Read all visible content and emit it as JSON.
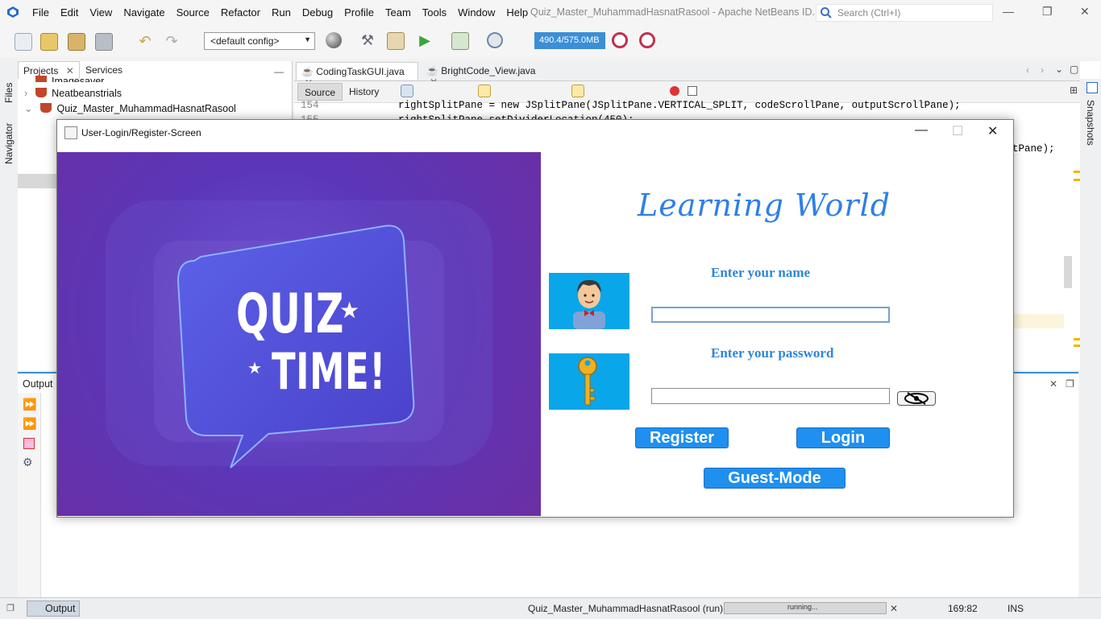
{
  "menubar": {
    "items": [
      "File",
      "Edit",
      "View",
      "Navigate",
      "Source",
      "Refactor",
      "Run",
      "Debug",
      "Profile",
      "Team",
      "Tools",
      "Window",
      "Help"
    ],
    "title": "Quiz_Master_MuhammadHasnatRasool - Apache NetBeans ID...",
    "search_placeholder": "Search (Ctrl+I)"
  },
  "toolbar": {
    "config": "<default config>",
    "memory": "490.4/575.0MB"
  },
  "left_strip": {
    "files": "Files",
    "navigator": "Navigator"
  },
  "projects": {
    "tab_projects": "Projects",
    "tab_services": "Services",
    "items": [
      "Imagesaver",
      "Neatbeanstrials",
      "Quiz_Master_MuhammadHasnatRasool"
    ]
  },
  "editor": {
    "tabs": [
      "CodingTaskGUI.java",
      "BrightCode_View.java"
    ],
    "source": "Source",
    "history": "History",
    "line1_num": "154",
    "line1_code": "rightSplitPane = new JSplitPane(JSplitPane.VERTICAL_SPLIT, codeScrollPane, outputScrollPane);",
    "line2_num": "155",
    "line2_code": "rightSplitPane.setDividerLocation(450);",
    "line3_code": "tPane);"
  },
  "right_strip": {
    "snapshots": "Snapshots"
  },
  "output": {
    "label": "Output",
    "bottom_tab": "Output"
  },
  "status": {
    "project": "Quiz_Master_MuhammadHasnatRasool (run)",
    "progress_text": "running...",
    "position": "169:82",
    "mode": "INS"
  },
  "dialog": {
    "title": "User-Login/Register-Screen",
    "image_text_line1": "QUIZ",
    "image_text_line2": "TIME!",
    "heading": "Learning World",
    "name_label": "Enter your name",
    "password_label": "Enter your password",
    "register": "Register",
    "login": "Login",
    "guest": "Guest-Mode"
  },
  "colors": {
    "accent": "#2f86d8",
    "button": "#1f8ff0",
    "memory_bar": "#3b8fd6"
  }
}
